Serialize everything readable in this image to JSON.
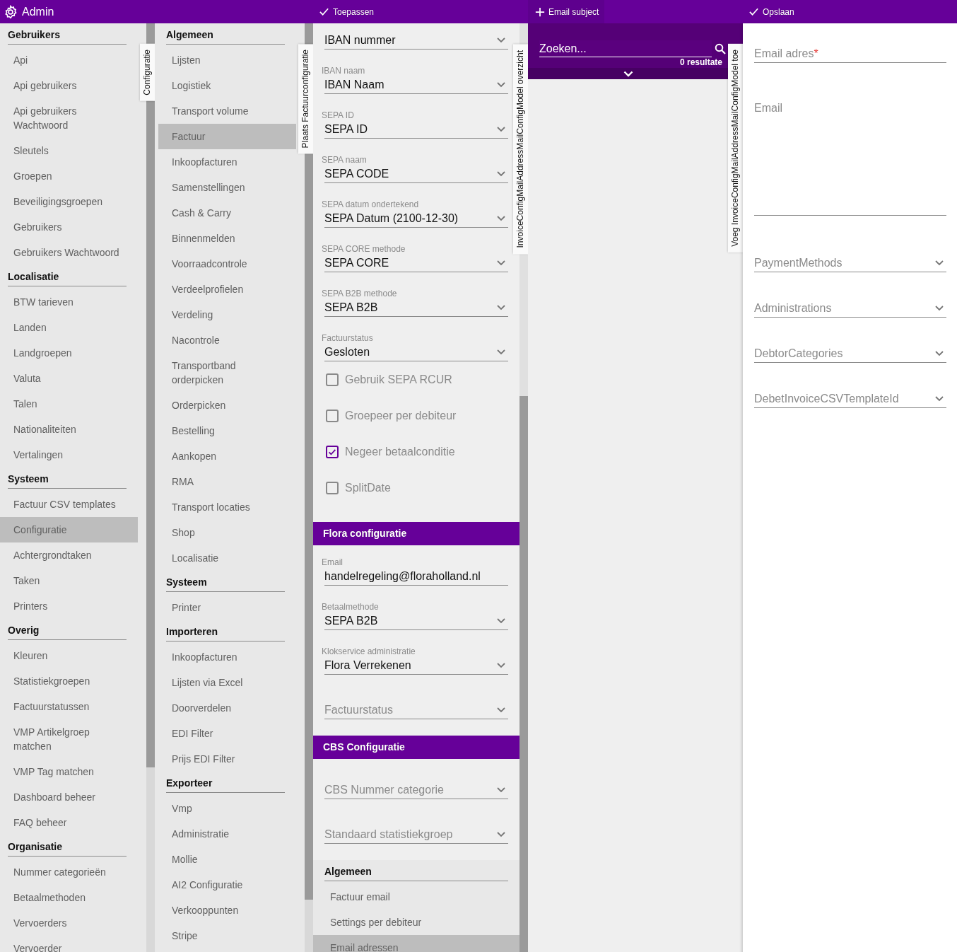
{
  "top_bar": {
    "title": "Admin",
    "apply_button": "Toepassen",
    "add_button": "Email subject",
    "save_button": "Opslaan"
  },
  "sidebar_primary": {
    "tab": "Configuratie",
    "sections": [
      {
        "heading": "Gebruikers",
        "items": [
          {
            "label": "Api",
            "selected": false
          },
          {
            "label": "Api gebruikers",
            "selected": false
          },
          {
            "label": "Api gebruikers Wachtwoord",
            "selected": false
          },
          {
            "label": "Sleutels",
            "selected": false
          },
          {
            "label": "Groepen",
            "selected": false
          },
          {
            "label": "Beveiligingsgroepen",
            "selected": false
          },
          {
            "label": "Gebruikers",
            "selected": false
          },
          {
            "label": "Gebruikers Wachtwoord",
            "selected": false
          }
        ]
      },
      {
        "heading": "Localisatie",
        "items": [
          {
            "label": "BTW tarieven",
            "selected": false
          },
          {
            "label": "Landen",
            "selected": false
          },
          {
            "label": "Landgroepen",
            "selected": false
          },
          {
            "label": "Valuta",
            "selected": false
          },
          {
            "label": "Talen",
            "selected": false
          },
          {
            "label": "Nationaliteiten",
            "selected": false
          },
          {
            "label": "Vertalingen",
            "selected": false
          }
        ]
      },
      {
        "heading": "Systeem",
        "items": [
          {
            "label": "Factuur CSV templates",
            "selected": false
          },
          {
            "label": "Configuratie",
            "selected": true
          },
          {
            "label": "Achtergrondtaken",
            "selected": false
          },
          {
            "label": "Taken",
            "selected": false
          },
          {
            "label": "Printers",
            "selected": false
          }
        ]
      },
      {
        "heading": "Overig",
        "items": [
          {
            "label": "Kleuren",
            "selected": false
          },
          {
            "label": "Statistiekgroepen",
            "selected": false
          },
          {
            "label": "Factuurstatussen",
            "selected": false
          },
          {
            "label": "VMP Artikelgroep matchen",
            "selected": false
          },
          {
            "label": "VMP Tag matchen",
            "selected": false
          },
          {
            "label": "Dashboard beheer",
            "selected": false
          },
          {
            "label": "FAQ beheer",
            "selected": false
          }
        ]
      },
      {
        "heading": "Organisatie",
        "items": [
          {
            "label": "Nummer categorieën",
            "selected": false
          },
          {
            "label": "Betaalmethoden",
            "selected": false
          },
          {
            "label": "Vervoerders",
            "selected": false
          },
          {
            "label": "Vervoerder",
            "selected": false
          }
        ]
      }
    ]
  },
  "sidebar_config": {
    "tab": "Plaats Factuurconfiguratie",
    "sections": [
      {
        "heading": "Algemeen",
        "items": [
          {
            "label": "Lijsten",
            "selected": false
          },
          {
            "label": "Logistiek",
            "selected": false
          },
          {
            "label": "Transport volume",
            "selected": false
          },
          {
            "label": "Factuur",
            "selected": true
          },
          {
            "label": "Inkoopfacturen",
            "selected": false
          },
          {
            "label": "Samenstellingen",
            "selected": false
          },
          {
            "label": "Cash & Carry",
            "selected": false
          },
          {
            "label": "Binnenmelden",
            "selected": false
          },
          {
            "label": "Voorraadcontrole",
            "selected": false
          },
          {
            "label": "Verdeelprofielen",
            "selected": false
          },
          {
            "label": "Verdeling",
            "selected": false
          },
          {
            "label": "Nacontrole",
            "selected": false
          },
          {
            "label": "Transportband orderpicken",
            "selected": false
          },
          {
            "label": "Orderpicken",
            "selected": false
          },
          {
            "label": "Bestelling",
            "selected": false
          },
          {
            "label": "Aankopen",
            "selected": false
          },
          {
            "label": "RMA",
            "selected": false
          },
          {
            "label": "Transport locaties",
            "selected": false
          },
          {
            "label": "Shop",
            "selected": false
          },
          {
            "label": "Localisatie",
            "selected": false
          }
        ]
      },
      {
        "heading": "Systeem",
        "items": [
          {
            "label": "Printer",
            "selected": false
          }
        ]
      },
      {
        "heading": "Importeren",
        "items": [
          {
            "label": "Inkoopfacturen",
            "selected": false
          },
          {
            "label": "Lijsten via Excel",
            "selected": false
          },
          {
            "label": "Doorverdelen",
            "selected": false
          },
          {
            "label": "EDI Filter",
            "selected": false
          },
          {
            "label": "Prijs EDI Filter",
            "selected": false
          }
        ]
      },
      {
        "heading": "Exporteer",
        "items": [
          {
            "label": "Vmp",
            "selected": false
          },
          {
            "label": "Administratie",
            "selected": false
          },
          {
            "label": "Mollie",
            "selected": false
          },
          {
            "label": "AI2 Configuratie",
            "selected": false
          },
          {
            "label": "Verkooppunten",
            "selected": false
          },
          {
            "label": "Stripe",
            "selected": false
          }
        ]
      }
    ]
  },
  "invoice_form": {
    "tab": "InvoiceConfigMailAddressMailConfigModel overzicht",
    "groups": [
      {
        "fields": [
          {
            "kind": "select",
            "value": "IBAN nummer"
          },
          {
            "kind": "select",
            "label": "IBAN naam",
            "value": "IBAN Naam"
          },
          {
            "kind": "select",
            "label": "SEPA ID",
            "value": "SEPA ID"
          },
          {
            "kind": "select",
            "label": "SEPA naam",
            "value": "SEPA CODE"
          },
          {
            "kind": "select",
            "label": "SEPA datum ondertekend",
            "value": "SEPA Datum (2100-12-30)"
          },
          {
            "kind": "select",
            "label": "SEPA CORE methode",
            "value": "SEPA CORE"
          },
          {
            "kind": "select",
            "label": "SEPA B2B methode",
            "value": "SEPA B2B"
          },
          {
            "kind": "select",
            "label": "Factuurstatus",
            "value": "Gesloten"
          },
          {
            "kind": "checkbox",
            "label": "Gebruik SEPA RCUR",
            "checked": false
          },
          {
            "kind": "checkbox",
            "label": "Groepeer per debiteur",
            "checked": false
          },
          {
            "kind": "checkbox",
            "label": "Negeer betaalconditie",
            "checked": true
          },
          {
            "kind": "checkbox",
            "label": "SplitDate",
            "checked": false
          }
        ]
      },
      {
        "title": "Flora configuratie",
        "fields": [
          {
            "kind": "text",
            "label": "Email",
            "value": "handelregeling@floraholland.nl"
          },
          {
            "kind": "select",
            "label": "Betaalmethode",
            "value": "SEPA B2B"
          },
          {
            "kind": "select",
            "label": "Klokservice administratie",
            "value": "Flora Verrekenen"
          },
          {
            "kind": "select",
            "placeholder": "Factuurstatus"
          }
        ]
      },
      {
        "title": "CBS Configuratie",
        "fields": [
          {
            "kind": "select",
            "placeholder": "CBS Nummer categorie"
          },
          {
            "kind": "select",
            "placeholder": "Standaard statistiekgroep"
          }
        ]
      }
    ],
    "nav": {
      "heading": "Algemeen",
      "items": [
        {
          "label": "Factuur email",
          "selected": false
        },
        {
          "label": "Settings per debiteur",
          "selected": false
        },
        {
          "label": "Email adressen",
          "selected": true
        }
      ]
    }
  },
  "overview": {
    "tab": "Voeg InvoiceConfigMailAddressMailConfigModel toe",
    "search": {
      "placeholder": "Zoeken..."
    },
    "result_count": "0 resultate"
  },
  "add_form": {
    "fields": [
      {
        "kind": "text",
        "placeholder": "Email adres",
        "required_mark": "*"
      },
      {
        "kind": "textarea",
        "placeholder": "Email"
      },
      {
        "kind": "select",
        "placeholder": "PaymentMethods"
      },
      {
        "kind": "select",
        "placeholder": "Administrations"
      },
      {
        "kind": "select",
        "placeholder": "DebtorCategories"
      },
      {
        "kind": "select",
        "placeholder": "DebetInvoiceCSVTemplateId"
      }
    ]
  }
}
